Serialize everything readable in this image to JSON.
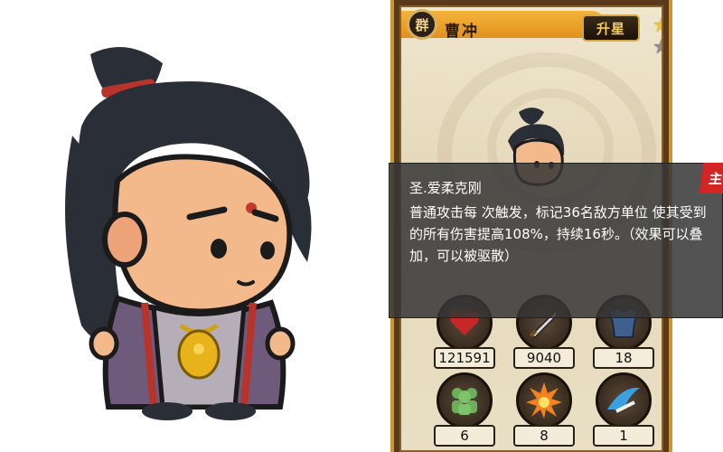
{
  "hero": {
    "faction_badge": "群",
    "name": "曹冲",
    "upgrade_label": "升星",
    "stars_filled": 1,
    "stars_total": 2
  },
  "skill": {
    "name": "圣.爱柔克刚",
    "description": "普通攻击每  次触发，标记36名敌方单位  使其受到的所有伤害提高108%，持续16秒。（效果可以叠加，可以被驱散）",
    "main_tag": "主"
  },
  "stats": [
    {
      "icon": "heart-icon",
      "value": "121591"
    },
    {
      "icon": "sword-icon",
      "value": "9040"
    },
    {
      "icon": "armor-icon",
      "value": "18"
    },
    {
      "icon": "troops-icon",
      "value": "6"
    },
    {
      "icon": "explosion-icon",
      "value": "8"
    },
    {
      "icon": "dash-icon",
      "value": "1"
    }
  ],
  "colors": {
    "frame": "#c9962f",
    "title_bar": "#e2901c",
    "skill_box": "#373737",
    "main_tag": "#d42424",
    "star_gold": "#f4c430",
    "star_gray": "#8d8d8d"
  }
}
